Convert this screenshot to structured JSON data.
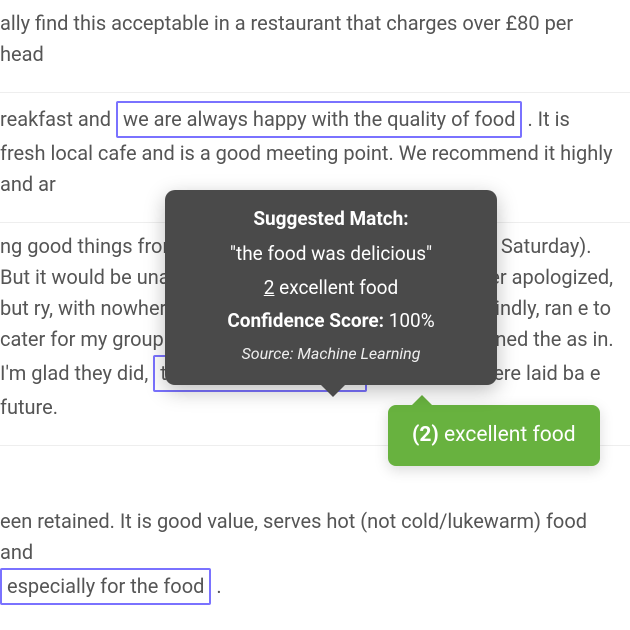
{
  "para1": "ally find this acceptable in a restaurant that charges over  £80 per head",
  "p2_pre": "reakfast and ",
  "p2_hl": "we are always happy with the quality of food",
  "p2_post": " . It is fresh local cafe and is a good meeting point. We recommend it highly and ar",
  "p3_a": "ng good things from it so booked for a family lunch on a Saturday). But it would be unable to accommodate us. The manager apologized, but ",
  "p3_b": "ry, with nowhere for us to sit. Our waiter came very kindly, ran e to cater for my group. As that proved unsuccessful, he phoned the as in. I'm glad they did, ",
  "p3_hl": "the food was delicious",
  "p3_c": " , the atmosphere laid ba e future.",
  "p4_pre": "een retained. It is good value, serves hot (not cold/lukewarm) food and ",
  "p4_hl": "especially for the food",
  "p4_post": " .",
  "tt": {
    "title": "Suggested Match:",
    "quote": "\"the food was delicious\"",
    "cat_num": "2",
    "cat_label": " excellent food",
    "conf_label": "Confidence Score: ",
    "conf_val": "100%",
    "source": "Source: Machine Learning"
  },
  "badge_q": "?",
  "badge_c": "✓",
  "tag": {
    "num": "(2)",
    "label": "  excellent food"
  }
}
